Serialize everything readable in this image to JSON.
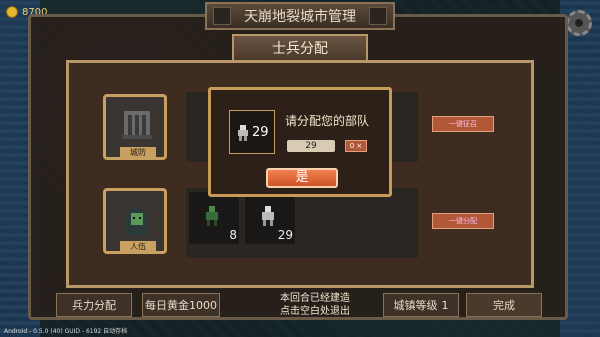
{
  "top": {
    "gold_value": "8700",
    "window_title": "天崩地裂城市管理"
  },
  "panel": {
    "title": "士兵分配",
    "row1": {
      "label": "城防",
      "action": "一键征召"
    },
    "row2": {
      "label": "人伍",
      "action": "一键分配",
      "units": [
        {
          "icon": "soldier-green-icon",
          "count": "8"
        },
        {
          "icon": "soldier-white-icon",
          "count": "29"
        }
      ]
    }
  },
  "popup": {
    "unit_count": "29",
    "prompt": "请分配您的部队",
    "input_value": "29",
    "clear_label": "0 ×",
    "confirm_label": "是"
  },
  "bottom": {
    "troop_alloc": "兵力分配",
    "daily_gold_label": "每日黄金",
    "daily_gold_value": "1000",
    "round_msg_1": "本回合已经建造",
    "round_msg_2": "点击空白处退出",
    "town_level_label": "城镇等级",
    "town_level_value": "1",
    "done": "完成"
  },
  "footer": "Android - 0.5.0 (40)   GUID - 6192   自动存档",
  "colors": {
    "accent": "#d05428",
    "frame": "#c89a58"
  }
}
